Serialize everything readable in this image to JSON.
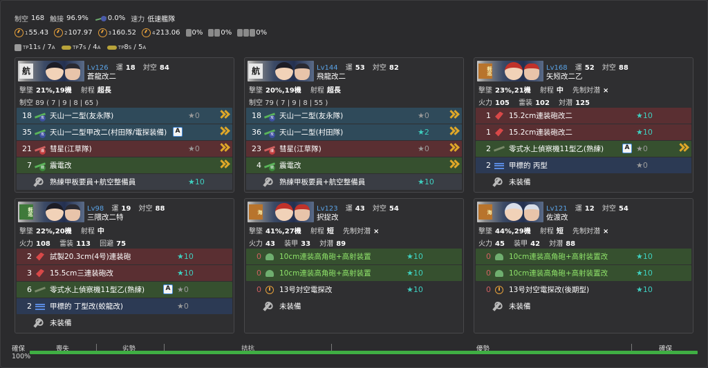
{
  "summary": {
    "air_control_label": "制空",
    "air_control_value": "168",
    "touch_label": "触接",
    "touch_value": "96.9%",
    "aa_cutin_value": "0.0%",
    "speed_label": "速力",
    "speed_value": "低速艦隊",
    "los": [
      {
        "sub": "1",
        "value": "55.43"
      },
      {
        "sub": "2",
        "value": "107.97"
      },
      {
        "sub": "3",
        "value": "160.52"
      },
      {
        "sub": "4",
        "value": "213.06"
      }
    ],
    "drum_rates": [
      "0%",
      "0%",
      "0%"
    ],
    "tp": [
      {
        "label": "TP",
        "s": "11",
        "a": "7"
      },
      {
        "label": "TP",
        "s": "7",
        "a": "4"
      },
      {
        "label": "TP",
        "s": "8",
        "a": "5"
      }
    ],
    "s_sub": "S",
    "a_sub": "A"
  },
  "ships": [
    {
      "level": "Lv126",
      "luck_label": "運",
      "luck": "18",
      "asw_label": "対空",
      "asw": "84",
      "name": "蒼龍改二",
      "kanji": "航",
      "line1": {
        "k1": "撃墜",
        "v1": "21%,19機",
        "k2": "射程",
        "v2": "超長"
      },
      "line2_raw": "制空 89 ( 7 | 9 | 8 | 65 )",
      "slots": [
        {
          "count": "18",
          "name": "天山一二型(友永隊)",
          "star": "★0",
          "color": "blue",
          "icon": "torp-bomber"
        },
        {
          "count": "35",
          "name": "天山一二型甲改二(村田隊/電探装備)",
          "badge": "A",
          "color": "blue",
          "icon": "torp-bomber"
        },
        {
          "count": "21",
          "name": "彗星(江草隊)",
          "star": "★0",
          "color": "red",
          "icon": "dive-bomber"
        },
        {
          "count": "7",
          "name": "震電改",
          "color": "green",
          "icon": "fighter"
        },
        {
          "count": "",
          "name": "熟練甲板要員+航空整備員",
          "star": "★10",
          "color": "gray",
          "icon": "wrench"
        }
      ]
    },
    {
      "level": "Lv144",
      "luck_label": "運",
      "luck": "53",
      "asw_label": "対空",
      "asw": "82",
      "name": "飛龍改二",
      "kanji": "航",
      "line1": {
        "k1": "撃墜",
        "v1": "20%,19機",
        "k2": "射程",
        "v2": "超長"
      },
      "line2_raw": "制空 79 ( 7 | 9 | 8 | 55 )",
      "slots": [
        {
          "count": "18",
          "name": "天山一二型(友永隊)",
          "star": "★0",
          "color": "blue",
          "icon": "torp-bomber"
        },
        {
          "count": "36",
          "name": "天山一二型(村田隊)",
          "star": "★2",
          "color": "blue",
          "icon": "torp-bomber"
        },
        {
          "count": "23",
          "name": "彗星(江草隊)",
          "star": "★0",
          "color": "red",
          "icon": "dive-bomber"
        },
        {
          "count": "4",
          "name": "震電改",
          "color": "green",
          "icon": "fighter"
        },
        {
          "count": "",
          "name": "熟練甲板要員+航空整備員",
          "star": "★10",
          "color": "gray",
          "icon": "wrench"
        }
      ]
    },
    {
      "level": "Lv168",
      "luck_label": "運",
      "luck": "52",
      "asw_label": "対空",
      "asw": "88",
      "name": "矢矧改二乙",
      "kanji": "軽巡",
      "line1": {
        "k1": "撃墜",
        "v1": "23%,21機",
        "k2": "射程",
        "v2": "中",
        "k3": "先制対潜",
        "v3": "×"
      },
      "line2": {
        "k1": "火力",
        "v1": "105",
        "k2": "雷装",
        "v2": "102",
        "k3": "対潜",
        "v3": "125"
      },
      "slots": [
        {
          "count": "1",
          "name": "15.2cm連装砲改二",
          "star": "★10",
          "color": "red",
          "icon": "gun"
        },
        {
          "count": "1",
          "name": "15.2cm連装砲改二",
          "star": "★10",
          "color": "red",
          "icon": "gun"
        },
        {
          "count": "2",
          "name": "零式水上偵察機11型乙(熟練)",
          "badge": "A",
          "star": "★0",
          "color": "green",
          "icon": "seaplane"
        },
        {
          "count": "2",
          "name": "甲標的 丙型",
          "star": "★0",
          "color": "navy",
          "icon": "midget-sub"
        },
        {
          "count": "",
          "name": "未装備",
          "color": "dark",
          "icon": "wrench"
        }
      ]
    },
    {
      "level": "Lv98",
      "luck_label": "運",
      "luck": "19",
      "asw_label": "対空",
      "asw": "88",
      "name": "三隈改二特",
      "kanji": "軽巡",
      "line1": {
        "k1": "撃墜",
        "v1": "22%,20機",
        "k2": "射程",
        "v2": "中"
      },
      "line2": {
        "k1": "火力",
        "v1": "108",
        "k2": "雷装",
        "v2": "113",
        "k3": "回避",
        "v3": "75"
      },
      "slots": [
        {
          "count": "2",
          "name": "試製20.3cm(4号)連装砲",
          "star": "★10",
          "color": "red",
          "icon": "gun"
        },
        {
          "count": "3",
          "name": "15.5cm三連装砲改",
          "star": "★10",
          "color": "red",
          "icon": "gun"
        },
        {
          "count": "6",
          "name": "零式水上偵察機11型乙(熟練)",
          "badge": "A",
          "star": "★0",
          "color": "green",
          "icon": "seaplane"
        },
        {
          "count": "2",
          "name": "甲標的 丁型改(蛟龍改)",
          "star": "★0",
          "color": "navy",
          "icon": "midget-sub"
        },
        {
          "count": "",
          "name": "未装備",
          "color": "dark",
          "icon": "wrench"
        }
      ]
    },
    {
      "level": "Lv123",
      "luck_label": "運",
      "luck": "43",
      "asw_label": "対空",
      "asw": "54",
      "name": "択捉改",
      "kanji": "海",
      "line1": {
        "k1": "撃墜",
        "v1": "41%,27機",
        "k2": "射程",
        "v2": "短",
        "k3": "先制対潜",
        "v3": "×"
      },
      "line2": {
        "k1": "火力",
        "v1": "43",
        "k2": "装甲",
        "v2": "33",
        "k3": "対潜",
        "v3": "89"
      },
      "slots": [
        {
          "count": "0",
          "name": "10cm連装高角砲+高射装置",
          "star": "★10",
          "color": "green",
          "icon": "aa-gun",
          "hl": true
        },
        {
          "count": "0",
          "name": "10cm連装高角砲+高射装置",
          "star": "★10",
          "color": "green",
          "icon": "aa-gun",
          "hl": true
        },
        {
          "count": "0",
          "name": "13号対空電探改",
          "star": "★10",
          "color": "dark",
          "icon": "radar"
        },
        {
          "count": "",
          "name": "未装備",
          "color": "dark",
          "icon": "wrench"
        }
      ]
    },
    {
      "level": "Lv121",
      "luck_label": "運",
      "luck": "12",
      "asw_label": "対空",
      "asw": "54",
      "name": "佐渡改",
      "kanji": "海",
      "line1": {
        "k1": "撃墜",
        "v1": "44%,29機",
        "k2": "射程",
        "v2": "短",
        "k3": "先制対潜",
        "v3": "×"
      },
      "line2": {
        "k1": "火力",
        "v1": "45",
        "k2": "装甲",
        "v2": "42",
        "k3": "対潜",
        "v3": "88"
      },
      "slots": [
        {
          "count": "0",
          "name": "10cm連装高角砲+高射装置改",
          "star": "★10",
          "color": "green",
          "icon": "aa-gun",
          "hl": true
        },
        {
          "count": "0",
          "name": "10cm連装高角砲+高射装置改",
          "star": "★10",
          "color": "green",
          "icon": "aa-gun",
          "hl": true
        },
        {
          "count": "0",
          "name": "13号対空電探改(後期型)",
          "star": "★10",
          "color": "dark",
          "icon": "radar"
        },
        {
          "count": "",
          "name": "未装備",
          "color": "dark",
          "icon": "wrench"
        }
      ]
    }
  ],
  "air_bar": {
    "left_label": "確保",
    "pct": "100%",
    "labels": [
      "喪失",
      "劣勢",
      "拮抗",
      "優勢",
      "確保"
    ],
    "fill_fraction": 1.0
  },
  "colors": {
    "accent_blue": "#5aa3e6",
    "bar_green": "#3fae43",
    "chevron": "#e0a828",
    "star_cyan": "#3fd0c0"
  }
}
